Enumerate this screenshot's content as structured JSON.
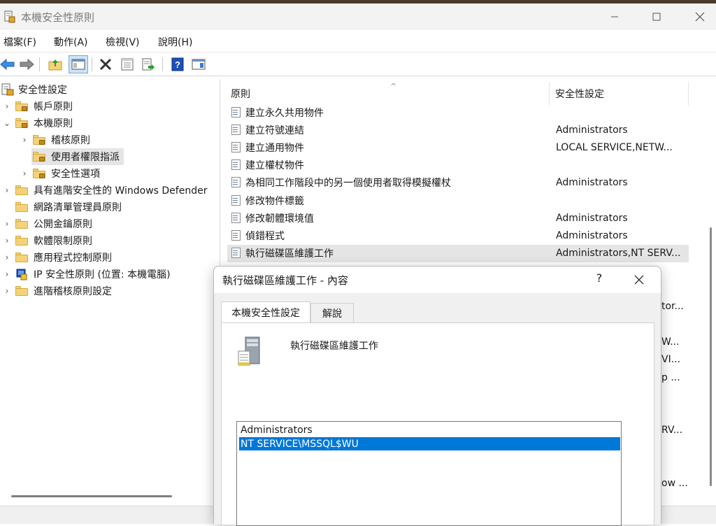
{
  "window": {
    "title": "本機安全性原則",
    "controls": {
      "minimize": "—",
      "maximize": "☐",
      "close": "✕"
    }
  },
  "menu": [
    "檔案(F)",
    "動作(A)",
    "檢視(V)",
    "說明(H)"
  ],
  "toolbar": {
    "icons": [
      "back-icon",
      "forward-icon",
      "up-folder-icon",
      "show-hide-tree-icon",
      "delete-icon",
      "properties-icon",
      "export-list-icon",
      "help-icon",
      "show-action-pane-icon"
    ]
  },
  "tree": {
    "root": "安全性設定",
    "items": [
      {
        "label": "帳戶原則",
        "level": 1,
        "expanded": false
      },
      {
        "label": "本機原則",
        "level": 1,
        "expanded": true
      },
      {
        "label": "稽核原則",
        "level": 2,
        "expanded": false
      },
      {
        "label": "使用者權限指派",
        "level": 2,
        "selected": true
      },
      {
        "label": "安全性選項",
        "level": 2,
        "expanded": false
      },
      {
        "label": "具有進階安全性的 Windows Defender",
        "level": 1,
        "expanded": false
      },
      {
        "label": "網路清單管理員原則",
        "level": 1
      },
      {
        "label": "公開金鑰原則",
        "level": 1,
        "expanded": false
      },
      {
        "label": "軟體限制原則",
        "level": 1,
        "expanded": false
      },
      {
        "label": "應用程式控制原則",
        "level": 1,
        "expanded": false
      },
      {
        "label": "IP 安全性原則 (位置: 本機電腦)",
        "level": 1,
        "expanded": false
      },
      {
        "label": "進階稽核原則設定",
        "level": 1,
        "expanded": false
      }
    ]
  },
  "list": {
    "columns": [
      "原則",
      "安全性設定"
    ],
    "sort_indicator": "^",
    "rows": [
      {
        "policy": "建立永久共用物件",
        "setting": ""
      },
      {
        "policy": "建立符號連結",
        "setting": "Administrators"
      },
      {
        "policy": "建立通用物件",
        "setting": "LOCAL SERVICE,NETW..."
      },
      {
        "policy": "建立權杖物件",
        "setting": ""
      },
      {
        "policy": "為相同工作階段中的另一個使用者取得模擬權杖",
        "setting": "Administrators"
      },
      {
        "policy": "修改物件標籤",
        "setting": ""
      },
      {
        "policy": "修改韌體環境值",
        "setting": "Administrators"
      },
      {
        "policy": "偵錯程式",
        "setting": "Administrators"
      },
      {
        "policy": "執行磁碟區維護工作",
        "setting": "Administrators,NT SERV...",
        "highlighted": true
      }
    ],
    "truncated_behind_dialog": [
      "tor...",
      "W...",
      "VI...",
      "p ...",
      "RV...",
      "ow ..."
    ]
  },
  "dialog": {
    "title": "執行磁碟區維護工作 - 內容",
    "help": "?",
    "close": "✕",
    "tabs": [
      "本機安全性設定",
      "解說"
    ],
    "policy_name": "執行磁碟區維護工作",
    "members": [
      {
        "name": "Administrators",
        "selected": false
      },
      {
        "name": "NT SERVICE\\MSSQL$WU",
        "selected": true
      }
    ]
  }
}
